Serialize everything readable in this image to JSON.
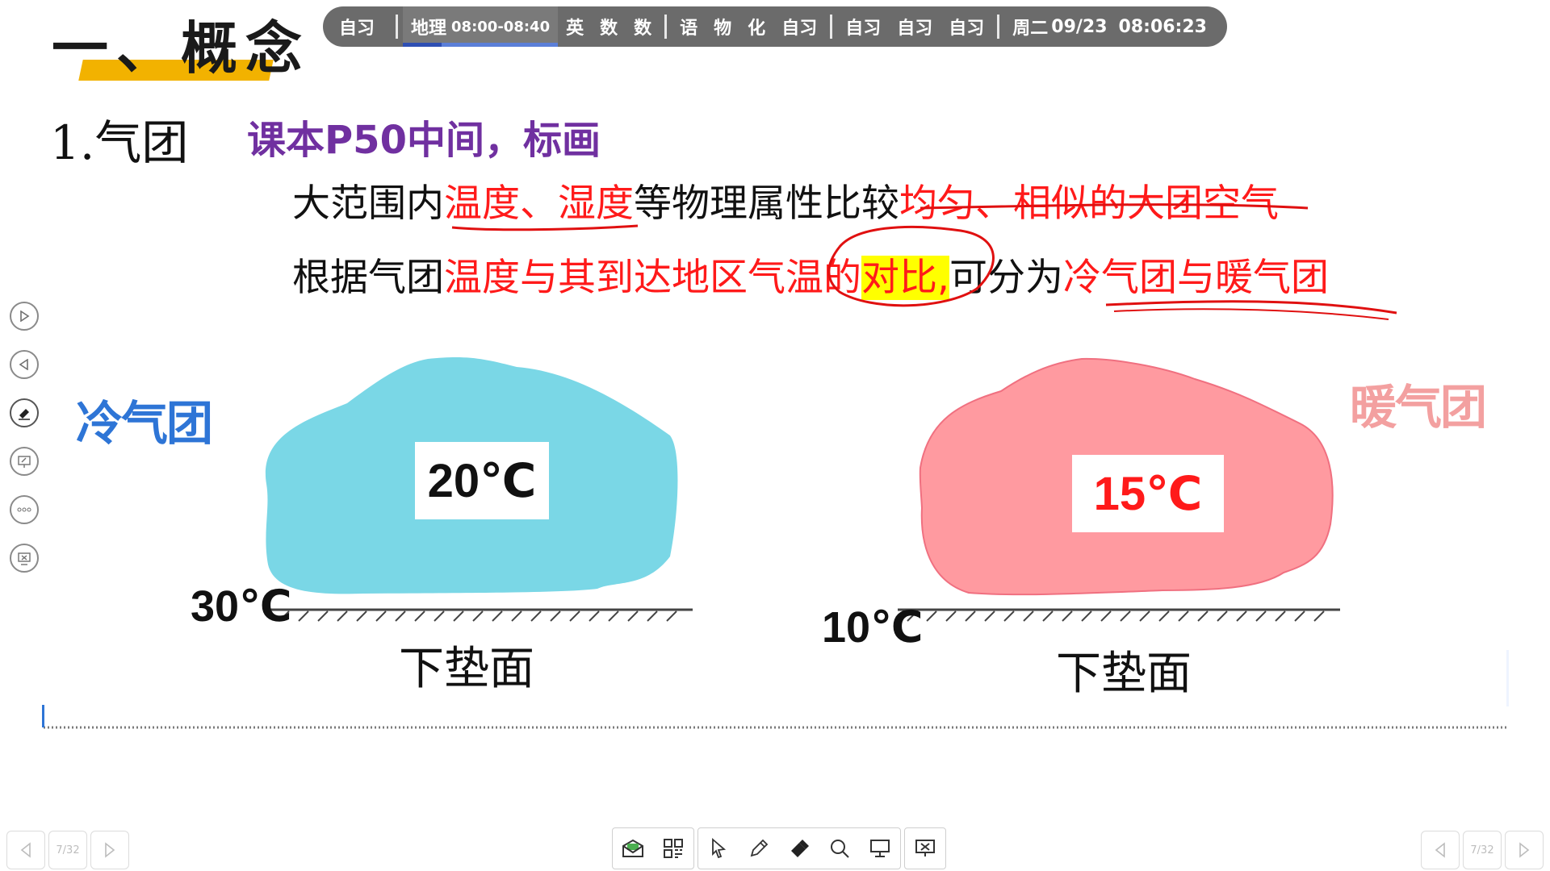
{
  "schedule": {
    "before": "自习",
    "current_subject": "地理",
    "current_time": "08:00-08:40",
    "current_progress_percent": 25,
    "group1": [
      "英",
      "数",
      "数"
    ],
    "group2": [
      "语",
      "物",
      "化",
      "自习"
    ],
    "group3": [
      "自习",
      "自习",
      "自习"
    ],
    "weekday": "周二",
    "date": "09/23",
    "clock": "08:06:23"
  },
  "slide": {
    "title": "一、概念",
    "heading": "1.气团",
    "note": "课本P50中间，标画",
    "line1": {
      "a": "大范围内",
      "b": "温度、湿度",
      "c": "等物理属性比较",
      "d": "均匀、相似的大团空气"
    },
    "line2": {
      "a": "根据气团",
      "b": "温度与其到达地区气温的",
      "c": "对比,",
      "d": "可分为",
      "e": "冷气团与暖气团"
    },
    "cold_label": "冷气团",
    "warm_label": "暖气团",
    "cold_air_temp": "20℃",
    "warm_air_temp": "15℃",
    "cold_ground_temp": "30℃",
    "warm_ground_temp": "10℃",
    "ground_label_left": "下垫面",
    "ground_label_right": "下垫面",
    "colors": {
      "cold_mass": "#7ad7e6",
      "warm_mass": "#ff9aa0",
      "emphasis_red": "#ff1a1a",
      "note_purple": "#7030a0",
      "title_bar": "#f2b200"
    }
  },
  "left_toolbar": [
    "next-icon",
    "prev-icon",
    "eraser-icon",
    "screen-annotate-icon",
    "more-icon",
    "exit-screen-icon"
  ],
  "bottom_nav": {
    "left_page": "7/32",
    "right_page": "7/32"
  },
  "bottom_tools": [
    "mail-icon",
    "grid-icon",
    "pointer-icon",
    "pen-icon",
    "eraser-icon",
    "search-icon",
    "board-icon",
    "close-screen-icon"
  ]
}
